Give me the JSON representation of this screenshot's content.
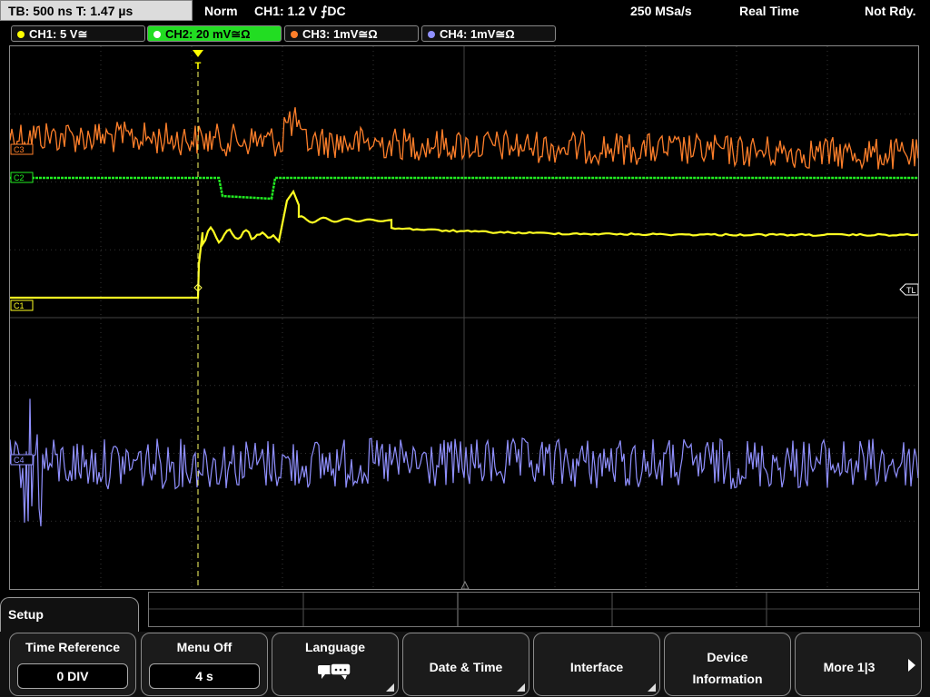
{
  "topbar": {
    "timebase": "TB: 500 ns   T: 1.47 µs",
    "trigger_mode": "Norm",
    "trigger_info": "CH1: 1.2 V ⨍DC",
    "sample_rate": "250 MSa/s",
    "acq_mode": "Real Time",
    "status": "Not Rdy."
  },
  "channels": [
    {
      "label": "CH1: 5 V≅",
      "color": "#ffff00",
      "active": false
    },
    {
      "label": "CH2: 20 mV≅Ω",
      "color": "#00ff00",
      "active": true
    },
    {
      "label": "CH3: 1mV≅Ω",
      "color": "#ff7f2a",
      "active": false
    },
    {
      "label": "CH4: 1mV≅Ω",
      "color": "#9090ff",
      "active": false
    }
  ],
  "markers": {
    "c1": "C1",
    "c2": "C2",
    "c3": "C3",
    "c4": "C4",
    "trigger_level": "TL",
    "trigger_pos": "T"
  },
  "menu": {
    "tab_title": "Setup",
    "time_reference": {
      "label": "Time Reference",
      "value": "0 DIV"
    },
    "menu_off": {
      "label": "Menu Off",
      "value": "4 s"
    },
    "language": {
      "label": "Language"
    },
    "date_time": {
      "label": "Date & Time"
    },
    "interface": {
      "label": "Interface"
    },
    "device_info": {
      "line1": "Device",
      "line2": "Information"
    },
    "more": {
      "label": "More 1|3"
    }
  },
  "icons": {
    "language": "speech-bubble-icon",
    "more": "arrow-right-icon",
    "submenu": "corner-triangle-icon"
  }
}
